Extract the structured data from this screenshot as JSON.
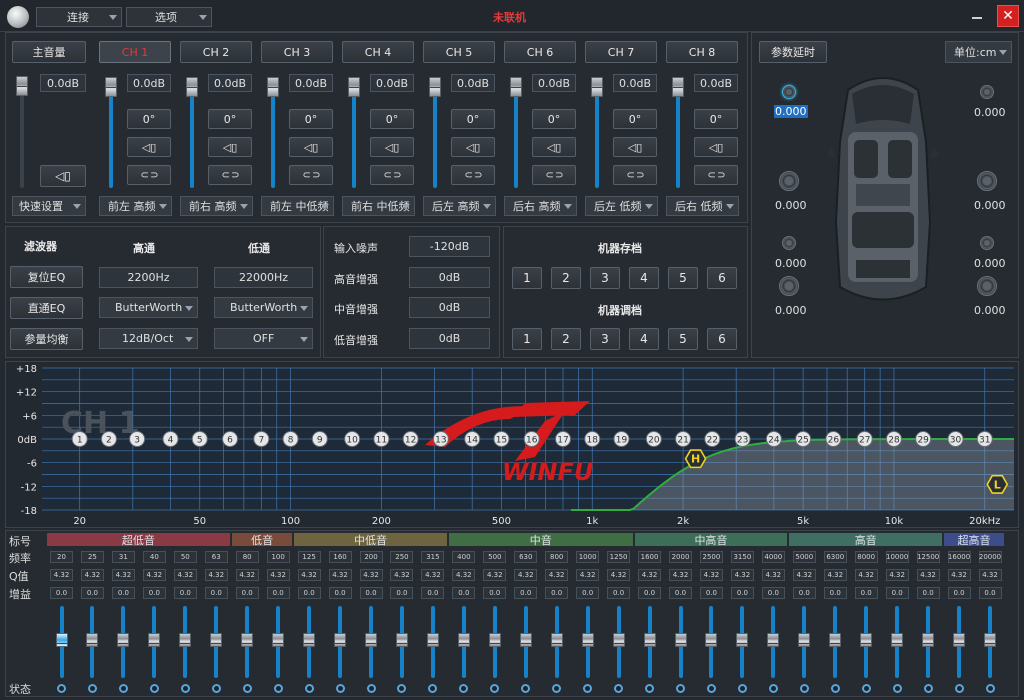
{
  "titlebar": {
    "menu_connect": "连接",
    "menu_options": "选项",
    "status": "未联机",
    "close": "✕"
  },
  "channels": {
    "master_label": "主音量",
    "master_db": "0.0dB",
    "tabs": [
      "CH 1",
      "CH 2",
      "CH 3",
      "CH 4",
      "CH 5",
      "CH 6",
      "CH 7",
      "CH 8"
    ],
    "db_values": [
      "0.0dB",
      "0.0dB",
      "0.0dB",
      "0.0dB",
      "0.0dB",
      "0.0dB",
      "0.0dB",
      "0.0dB"
    ],
    "phase_values": [
      "0°",
      "0°",
      "0°",
      "0°",
      "0°",
      "0°",
      "0°",
      "0°"
    ],
    "quick_setup": "快速设置",
    "assignments": [
      "前左 高频",
      "前右 高频",
      "前左 中低频",
      "前右 中低频",
      "后左 高频",
      "后右 高频",
      "后左 低频",
      "后右 低频"
    ]
  },
  "filter": {
    "title": "滤波器",
    "high_pass": "高通",
    "low_pass": "低通",
    "reset_eq": "复位EQ",
    "bypass_eq": "直通EQ",
    "param_eq": "参量均衡",
    "hp_freq": "2200Hz",
    "lp_freq": "22000Hz",
    "hp_type": "ButterWorth",
    "lp_type": "ButterWorth",
    "hp_slope": "12dB/Oct",
    "lp_slope": "OFF"
  },
  "input": {
    "noise_label": "输入噪声",
    "noise_value": "-120dB",
    "treble_label": "高音增强",
    "treble_value": "0dB",
    "mid_label": "中音增强",
    "mid_value": "0dB",
    "bass_label": "低音增强",
    "bass_value": "0dB"
  },
  "presets": {
    "save_title": "机器存档",
    "load_title": "机器调档",
    "slots": [
      "1",
      "2",
      "3",
      "4",
      "5",
      "6"
    ]
  },
  "delay": {
    "button": "参数延时",
    "unit": "单位:cm",
    "values": {
      "fl_tweeter": "0.000",
      "fr_tweeter": "0.000",
      "fl_mid": "0.000",
      "fr_mid": "0.000",
      "rl_high": "0.000",
      "rr_high": "0.000",
      "rl_low": "0.000",
      "rr_low": "0.000"
    }
  },
  "graph": {
    "channel_label": "CH 1",
    "y_labels": [
      "+18",
      "+12",
      "+6",
      "0dB",
      "-6",
      "-12",
      "-18"
    ],
    "x_labels": [
      "20",
      "50",
      "100",
      "200",
      "500",
      "1k",
      "2k",
      "5k",
      "10k",
      "20kHz"
    ],
    "band_points": [
      "1",
      "2",
      "3",
      "4",
      "5",
      "6",
      "7",
      "8",
      "9",
      "10",
      "11",
      "12",
      "13",
      "14",
      "15",
      "16",
      "17",
      "18",
      "19",
      "20",
      "21",
      "22",
      "23",
      "24",
      "25",
      "26",
      "27",
      "28",
      "29",
      "30",
      "31"
    ],
    "hp_marker": "H",
    "lp_marker": "L",
    "brand": "WINFU"
  },
  "eq": {
    "row_labels": {
      "label": "标号",
      "freq": "频率",
      "q": "Q值",
      "gain": "增益",
      "status": "状态"
    },
    "bands": [
      {
        "name": "超低音",
        "color": "#8a3a44"
      },
      {
        "name": "低音",
        "color": "#7a4a3a"
      },
      {
        "name": "中低音",
        "color": "#6e6440"
      },
      {
        "name": "中音",
        "color": "#3f6e45"
      },
      {
        "name": "中高音",
        "color": "#3d6e58"
      },
      {
        "name": "高音",
        "color": "#3f6e63"
      },
      {
        "name": "超高音",
        "color": "#3d4c8a"
      }
    ],
    "freqs": [
      "20",
      "25",
      "31",
      "40",
      "50",
      "63",
      "80",
      "100",
      "125",
      "160",
      "200",
      "250",
      "315",
      "400",
      "500",
      "630",
      "800",
      "1000",
      "1250",
      "1600",
      "2000",
      "2500",
      "3150",
      "4000",
      "5000",
      "6300",
      "8000",
      "10000",
      "12500",
      "16000",
      "20000"
    ],
    "q_value": "4.32",
    "gain_value": "0.0"
  }
}
